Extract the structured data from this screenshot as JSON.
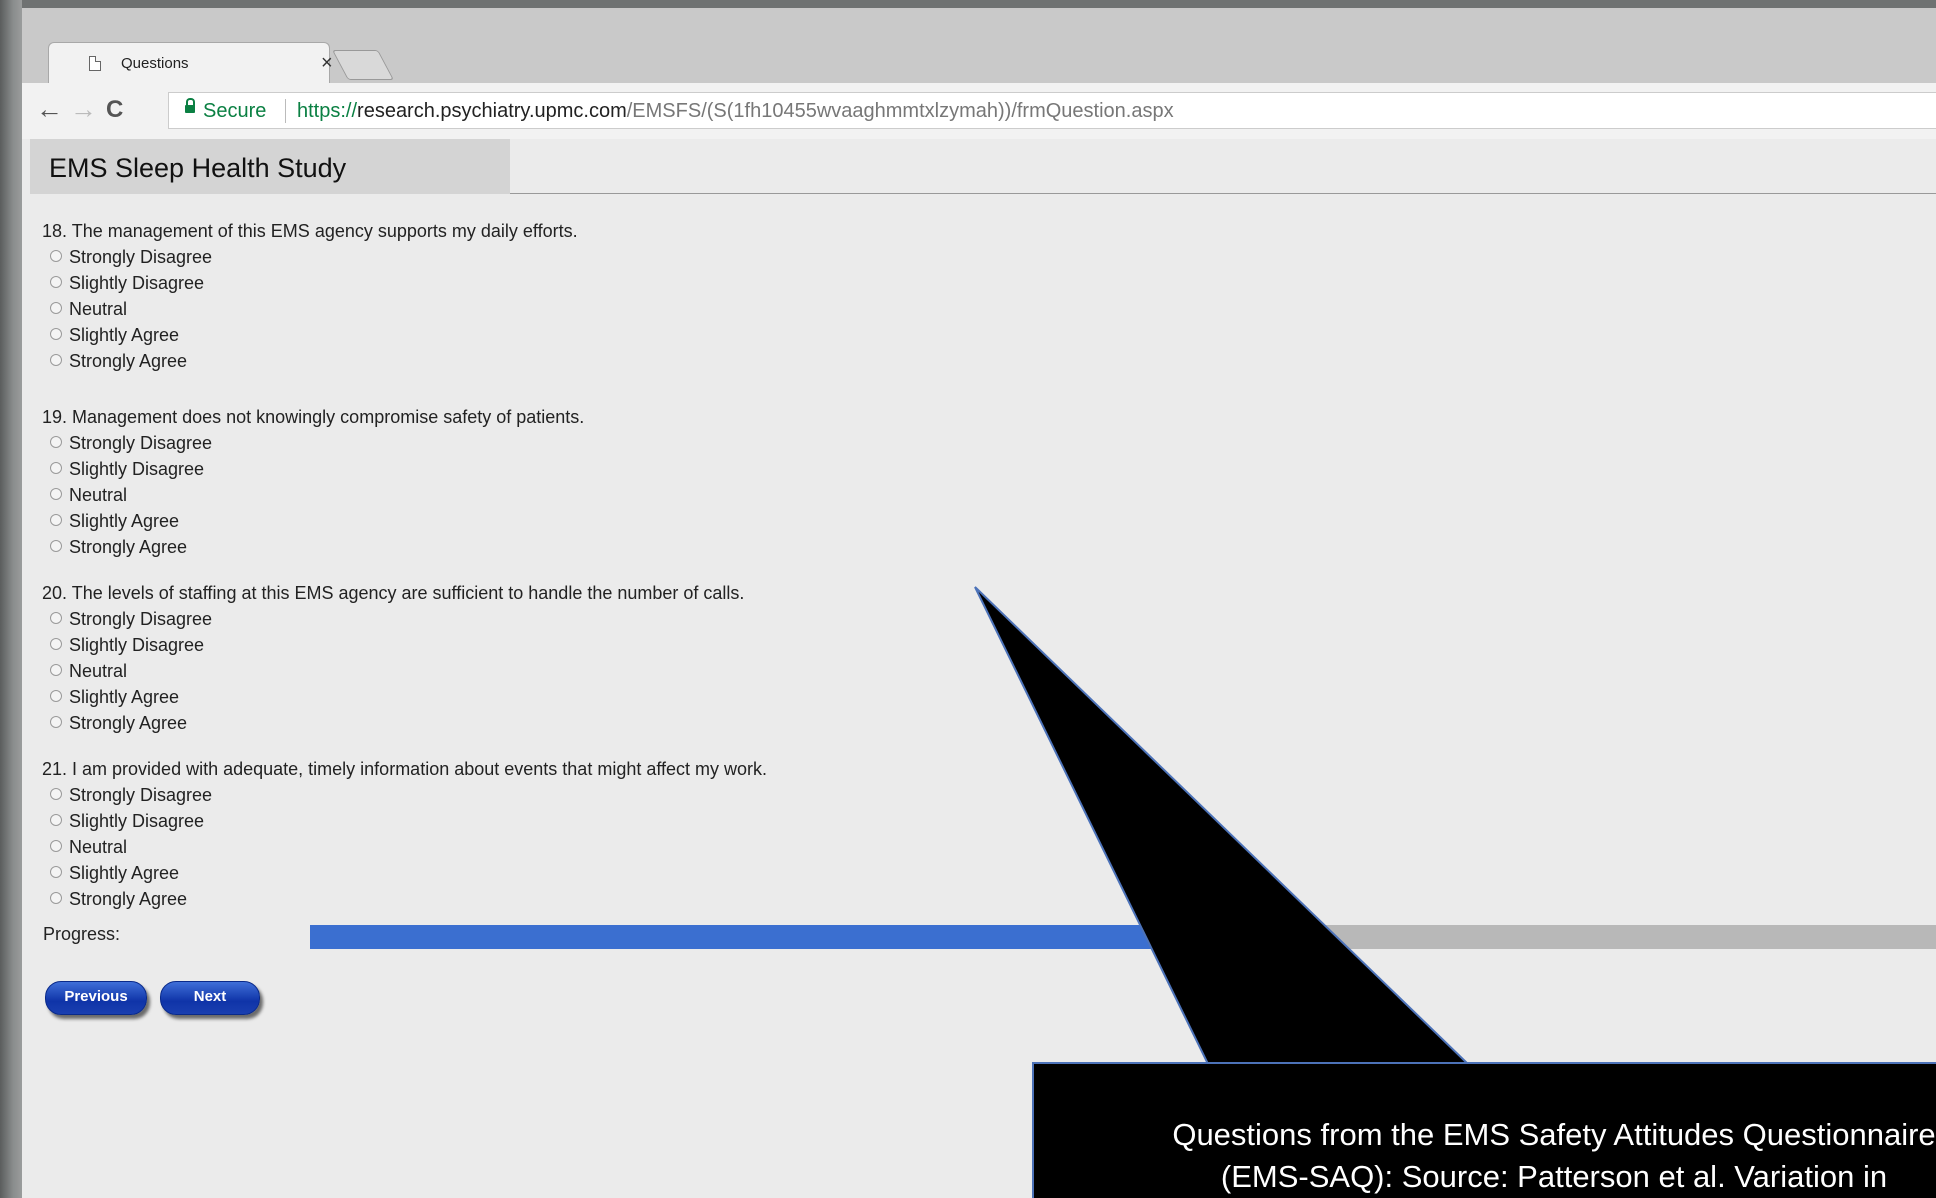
{
  "browser": {
    "tab_title": "Questions",
    "tab_close_glyph": "×",
    "back_glyph": "←",
    "forward_glyph": "→",
    "reload_glyph": "C",
    "secure_label": "Secure",
    "url": {
      "scheme": "https://",
      "host": "research.psychiatry.upmc.com",
      "path": "/EMSFS/(S(1fh10455wvaaghmmtxlzymah))/frmQuestion.aspx"
    }
  },
  "header": {
    "title": "EMS Sleep Health Study"
  },
  "questions": [
    {
      "text": "18. The management of this EMS agency supports my daily efforts.",
      "options": [
        "Strongly Disagree",
        "Slightly Disagree",
        "Neutral",
        "Slightly Agree",
        "Strongly Agree"
      ]
    },
    {
      "text": "19. Management does not knowingly compromise safety of patients.",
      "options": [
        "Strongly Disagree",
        "Slightly Disagree",
        "Neutral",
        "Slightly Agree",
        "Strongly Agree"
      ]
    },
    {
      "text": "20. The levels of staffing at this EMS agency are sufficient to handle the number of calls.",
      "options": [
        "Strongly Disagree",
        "Slightly Disagree",
        "Neutral",
        "Slightly Agree",
        "Strongly Agree"
      ]
    },
    {
      "text": "21. I am provided with adequate, timely information about events that might affect my work.",
      "options": [
        "Strongly Disagree",
        "Slightly Disagree",
        "Neutral",
        "Slightly Agree",
        "Strongly Agree"
      ]
    }
  ],
  "progress": {
    "label": "Progress:",
    "percent": 61.5
  },
  "buttons": {
    "previous": "Previous",
    "next": "Next"
  },
  "callout": {
    "line1": "Questions from the EMS Safety Attitudes Questionnaire",
    "line2": "(EMS-SAQ): Source: Patterson et al. Variation in"
  },
  "colors": {
    "progress_fill": "#3b6fd0",
    "progress_track": "#b8b8b8",
    "button": "#1a3fb0",
    "callout_bg": "#000000",
    "callout_border": "#4c72b8",
    "secure_green": "#0b8043"
  },
  "icons": [
    "page-icon",
    "close-icon",
    "new-tab-icon",
    "back-arrow-icon",
    "forward-arrow-icon",
    "reload-icon",
    "lock-icon",
    "radio-icon"
  ]
}
